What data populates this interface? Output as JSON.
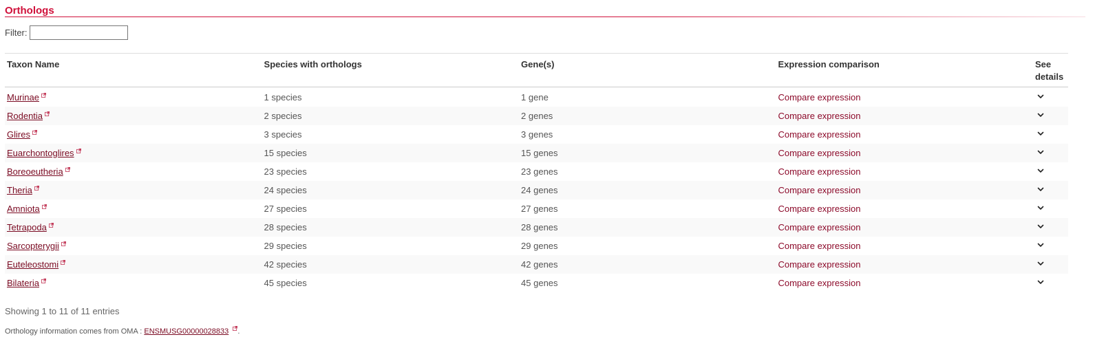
{
  "section": {
    "title": "Orthologs"
  },
  "filter": {
    "label": "Filter:",
    "value": ""
  },
  "table": {
    "headers": {
      "taxon": "Taxon Name",
      "species": "Species with orthologs",
      "genes": "Gene(s)",
      "expression": "Expression comparison",
      "details_line1": "See",
      "details_line2": "details"
    },
    "rows": [
      {
        "taxon": "Murinae",
        "species": "1 species",
        "genes": "1 gene",
        "expression": "Compare expression"
      },
      {
        "taxon": "Rodentia",
        "species": "2 species",
        "genes": "2 genes",
        "expression": "Compare expression"
      },
      {
        "taxon": "Glires",
        "species": "3 species",
        "genes": "3 genes",
        "expression": "Compare expression"
      },
      {
        "taxon": "Euarchontoglires",
        "species": "15 species",
        "genes": "15 genes",
        "expression": "Compare expression"
      },
      {
        "taxon": "Boreoeutheria",
        "species": "23 species",
        "genes": "23 genes",
        "expression": "Compare expression"
      },
      {
        "taxon": "Theria",
        "species": "24 species",
        "genes": "24 genes",
        "expression": "Compare expression"
      },
      {
        "taxon": "Amniota",
        "species": "27 species",
        "genes": "27 genes",
        "expression": "Compare expression"
      },
      {
        "taxon": "Tetrapoda",
        "species": "28 species",
        "genes": "28 genes",
        "expression": "Compare expression"
      },
      {
        "taxon": "Sarcopterygii",
        "species": "29 species",
        "genes": "29 genes",
        "expression": "Compare expression"
      },
      {
        "taxon": "Euteleostomi",
        "species": "42 species",
        "genes": "42 genes",
        "expression": "Compare expression"
      },
      {
        "taxon": "Bilateria",
        "species": "45 species",
        "genes": "45 genes",
        "expression": "Compare expression"
      }
    ]
  },
  "pagination": {
    "info": "Showing 1 to 11 of 11 entries"
  },
  "footer": {
    "text": "Orthology information comes from OMA : ",
    "link": "ENSMUSG00000028833",
    "suffix": "."
  },
  "icons": {
    "external": "external-link-icon",
    "details": "chevron-down-icon"
  },
  "colors": {
    "accent": "#d0103a",
    "link": "#7a0a22",
    "compare_link": "#8c0a2a"
  }
}
